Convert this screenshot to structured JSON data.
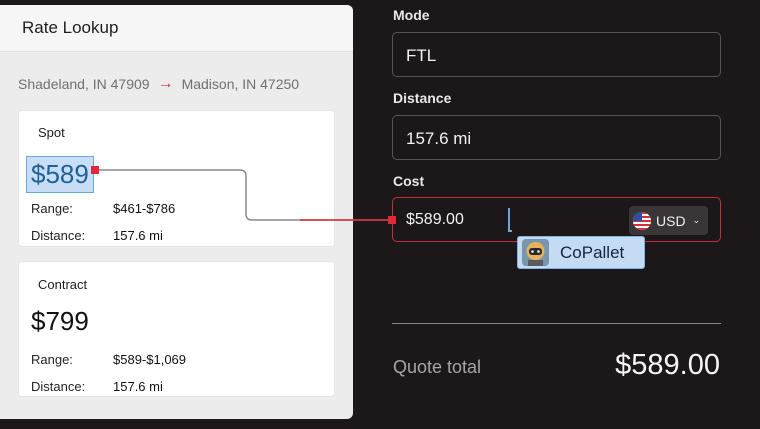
{
  "panel": {
    "title": "Rate Lookup",
    "origin": "Shadeland, IN 47909",
    "destination": "Madison, IN 47250",
    "spot": {
      "label": "Spot",
      "price": "$589",
      "range_label": "Range:",
      "range_value": "$461-$786",
      "distance_label": "Distance:",
      "distance_value": "157.6 mi"
    },
    "contract": {
      "label": "Contract",
      "price": "$799",
      "range_label": "Range:",
      "range_value": "$589-$1,069",
      "distance_label": "Distance:",
      "distance_value": "157.6 mi"
    }
  },
  "form": {
    "mode_label": "Mode",
    "mode_value": "FTL",
    "distance_label": "Distance",
    "distance_value": "157.6 mi",
    "cost_label": "Cost",
    "cost_value": "$589.00",
    "currency": "USD"
  },
  "badge": {
    "label": "CoPallet"
  },
  "totals": {
    "label": "Quote total",
    "value": "$589.00"
  },
  "colors": {
    "accent_red": "#e02a3a",
    "highlight_blue": "#c7dff6",
    "background_dark": "#1c1819"
  }
}
